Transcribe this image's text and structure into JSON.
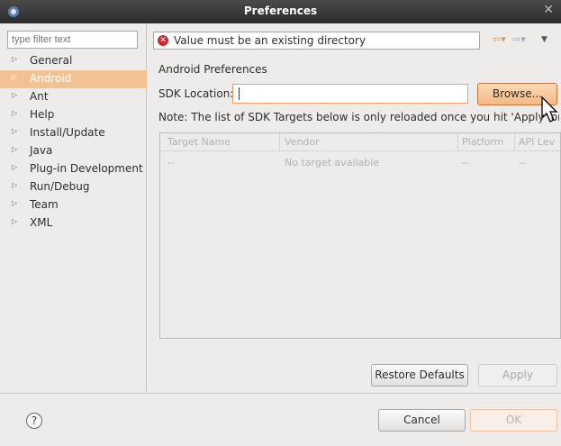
{
  "window": {
    "title": "Preferences"
  },
  "sidebar": {
    "filter_placeholder": "type filter text",
    "items": [
      {
        "label": "General"
      },
      {
        "label": "Android"
      },
      {
        "label": "Ant"
      },
      {
        "label": "Help"
      },
      {
        "label": "Install/Update"
      },
      {
        "label": "Java"
      },
      {
        "label": "Plug-in Development"
      },
      {
        "label": "Run/Debug"
      },
      {
        "label": "Team"
      },
      {
        "label": "XML"
      }
    ],
    "selected_index": 1
  },
  "message": {
    "text": "Value must be an existing directory"
  },
  "page": {
    "section_title": "Android Preferences",
    "sdk_label": "SDK Location:",
    "sdk_value": "",
    "browse_label": "Browse...",
    "note": "Note: The list of SDK Targets below is only reloaded once you hit 'Apply' or 'OK'.",
    "targets_table": {
      "columns": [
        "Target Name",
        "Vendor",
        "Platform",
        "API Lev"
      ],
      "row": [
        "--",
        "No target available",
        "--",
        "--"
      ]
    },
    "restore_label": "Restore Defaults",
    "apply_label": "Apply"
  },
  "footer": {
    "help_symbol": "?",
    "cancel_label": "Cancel",
    "ok_label": "OK"
  },
  "colors": {
    "selection": "#f3c293",
    "accent_orange": "#f5b983",
    "error_red": "#cc2a2a"
  }
}
